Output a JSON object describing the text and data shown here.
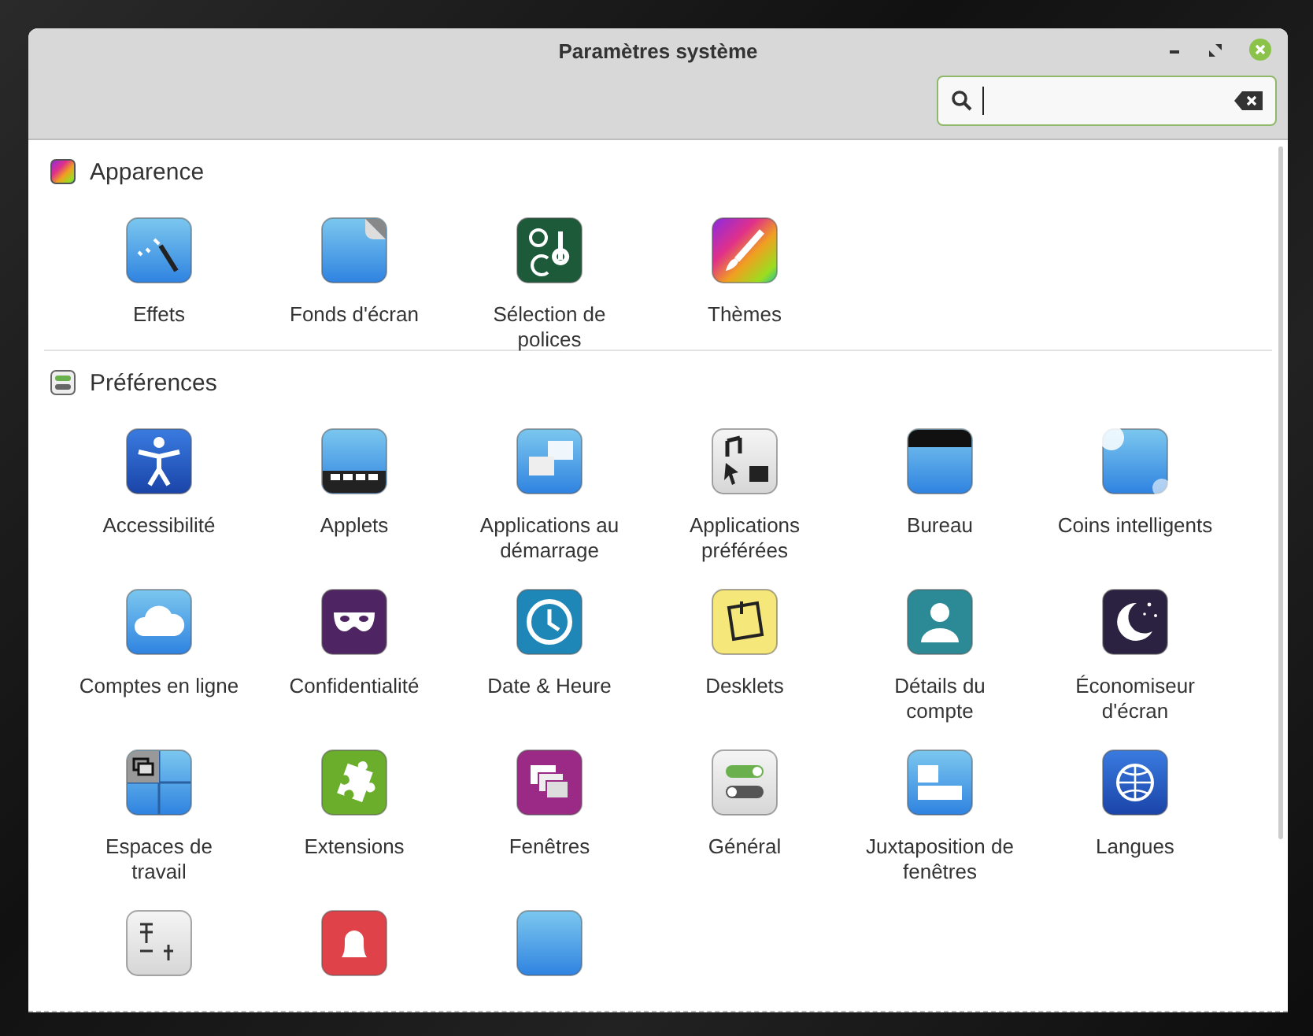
{
  "window": {
    "title": "Paramètres système"
  },
  "sections": [
    {
      "title": "Apparence",
      "kind": "appearance",
      "items": [
        {
          "label": "Effets"
        },
        {
          "label": "Fonds d'écran"
        },
        {
          "label": "Sélection de polices"
        },
        {
          "label": "Thèmes"
        }
      ]
    },
    {
      "title": "Préférences",
      "kind": "preferences",
      "items": [
        {
          "label": "Accessibilité"
        },
        {
          "label": "Applets"
        },
        {
          "label": "Applications au démarrage"
        },
        {
          "label": "Applications préférées"
        },
        {
          "label": "Bureau"
        },
        {
          "label": "Coins intelligents"
        },
        {
          "label": "Comptes en ligne"
        },
        {
          "label": "Confidentialité"
        },
        {
          "label": "Date & Heure"
        },
        {
          "label": "Desklets"
        },
        {
          "label": "Détails du compte"
        },
        {
          "label": "Économiseur d'écran"
        },
        {
          "label": "Espaces de travail"
        },
        {
          "label": "Extensions"
        },
        {
          "label": "Fenêtres"
        },
        {
          "label": "Général"
        },
        {
          "label": "Juxtaposition de fenêtres"
        },
        {
          "label": "Langues"
        }
      ]
    }
  ]
}
